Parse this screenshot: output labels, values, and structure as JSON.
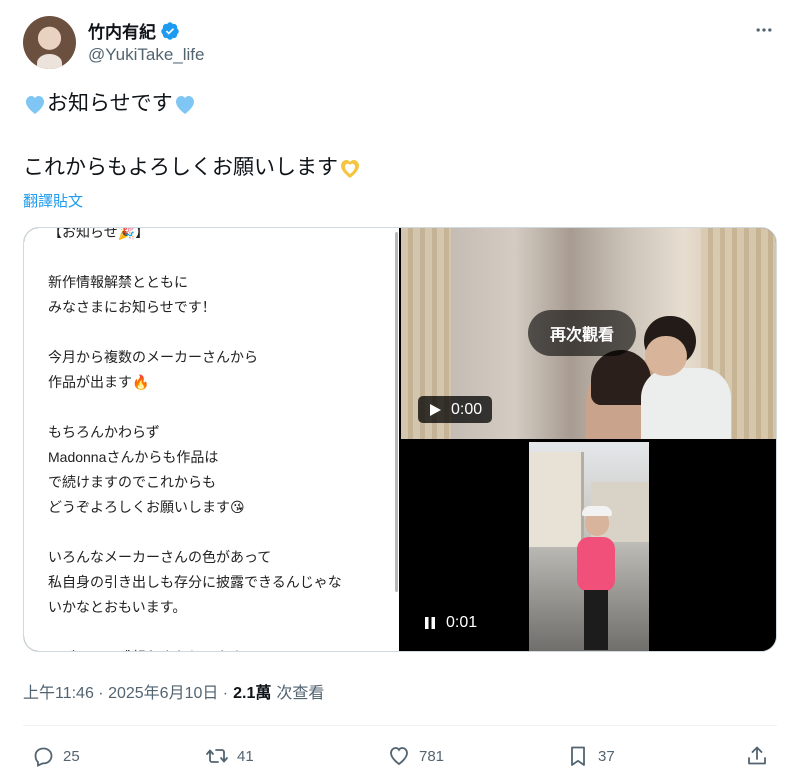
{
  "author": {
    "display_name": "竹内有紀",
    "handle": "@YukiTake_life",
    "verified_color": "#1d9bf0"
  },
  "tweet": {
    "line1_text": "お知らせです",
    "line2_text": "これからもよろしくお願いします",
    "translate_label": "翻譯貼文"
  },
  "media": {
    "note_text": "【お知らせ🎉】\n\n新作情報解禁とともに\nみなさまにお知らせです！\n\n今月から複数のメーカーさんから\n作品が出ます🔥\n\nもちろんかわらず\nMadonnaさんからも作品は\nで続けますのでこれからも\nどうぞよろしくお願いします😘\n\nいろんなメーカーさんの色があって\n私自身の引き出しも存分に披露できるんじゃな\nいかなとおもいます。\n\nレビュー、感想おまちしてます🫶",
    "video1": {
      "replay_label": "再次觀看",
      "time": "0:00"
    },
    "video2": {
      "time": "0:01"
    }
  },
  "meta": {
    "timestamp": "上午11:46 · 2025年6月10日 ·",
    "views_count": "2.1萬",
    "views_label": "次查看"
  },
  "actions": {
    "replies": "25",
    "reposts": "41",
    "likes": "781",
    "bookmarks": "37"
  },
  "colors": {
    "heart_blue": "#7fc6f5",
    "heart_yellow": "#f5c542",
    "link": "#1d9bf0",
    "muted": "#536471"
  }
}
